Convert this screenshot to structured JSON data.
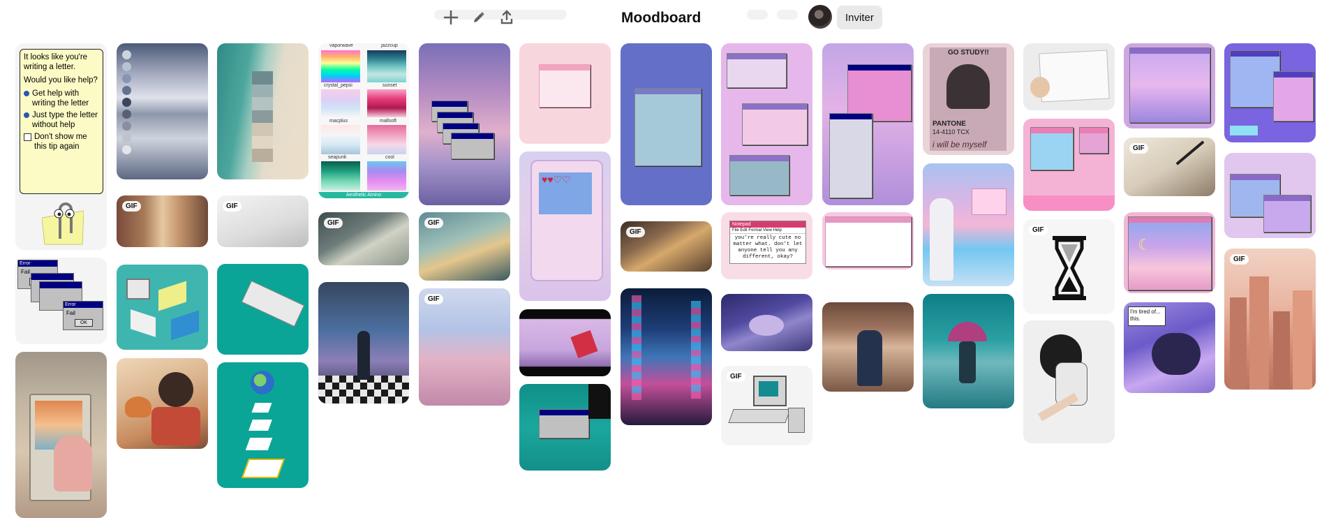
{
  "board": {
    "title": "Moodboard"
  },
  "header": {
    "invite_label": "Inviter",
    "tools": [
      "add-icon",
      "pencil-icon",
      "share-icon"
    ]
  },
  "badges": {
    "gif": "GIF"
  },
  "pins": {
    "clippy": {
      "intro": "It looks like you're writing a letter.",
      "question": "Would you like help?",
      "option1": "Get help with writing the letter",
      "option2": "Just type the letter without help",
      "option3": "Don't show me this tip again"
    },
    "error_dialog": {
      "title": "Error",
      "message": "Fail",
      "button": "OK"
    },
    "palettes": {
      "labels": [
        "vaporwave",
        "jazzcup",
        "crystal_pepsi",
        "sunset",
        "macplus",
        "mallsoft",
        "seapunk",
        "cool"
      ],
      "footer": "Aesthetic Amino"
    },
    "notepad": {
      "title": "Notepad",
      "menu": "File  Edit  Format  View  Help",
      "text": "you're really cute no matter what. don't let anyone tell you any different, okay?"
    },
    "pantone": {
      "heading": "GO STUDY!!",
      "brand": "PANTONE",
      "code": "14-4110 TCX",
      "caption": "i will be myself"
    },
    "comic": {
      "text": "I'm tired of... this."
    }
  }
}
